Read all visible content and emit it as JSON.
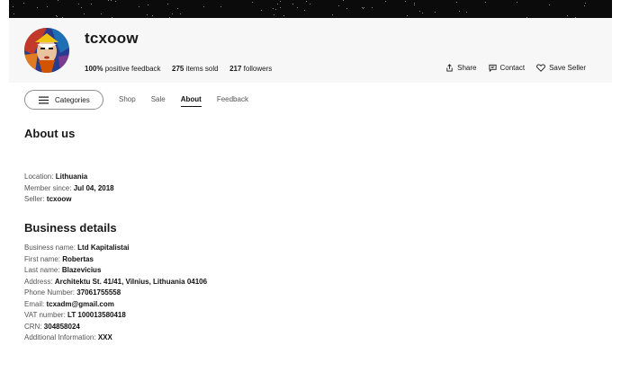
{
  "store": {
    "name": "tcxoow",
    "feedback_value": "100%",
    "feedback_label": "positive feedback",
    "items_sold_value": "275",
    "items_sold_label": "items sold",
    "followers_value": "217",
    "followers_label": "followers"
  },
  "actions": {
    "share": "Share",
    "contact": "Contact",
    "save": "Save Seller"
  },
  "nav": {
    "categories": "Categories",
    "tabs": [
      "Shop",
      "Sale",
      "About",
      "Feedback"
    ],
    "active_tab": "About"
  },
  "about": {
    "title": "About us",
    "rows": [
      {
        "label": "Location:",
        "value": "Lithuania"
      },
      {
        "label": "Member since:",
        "value": "Jul 04, 2018"
      },
      {
        "label": "Seller:",
        "value": "tcxoow"
      }
    ]
  },
  "business": {
    "title": "Business details",
    "rows": [
      {
        "label": "Business name:",
        "value": "Ltd Kapitalistai"
      },
      {
        "label": "First name:",
        "value": "Robertas"
      },
      {
        "label": "Last name:",
        "value": "Blazevicius"
      },
      {
        "label": "Address:",
        "value": "Architektu St. 41/41, Vilnius, Lithuania 04106"
      },
      {
        "label": "Phone Number:",
        "value": "37061755558"
      },
      {
        "label": "Email:",
        "value": "tcxadm@gmail.com"
      },
      {
        "label": "VAT number:",
        "value": "LT 100013580418"
      },
      {
        "label": "CRN:",
        "value": "304858024"
      },
      {
        "label": "Additional Information:",
        "value": "XXX"
      }
    ]
  },
  "colors": {
    "header_bg": "#f7f7f7",
    "banner_bg": "#0b0b0b",
    "text": "#191919",
    "muted": "#555555"
  }
}
